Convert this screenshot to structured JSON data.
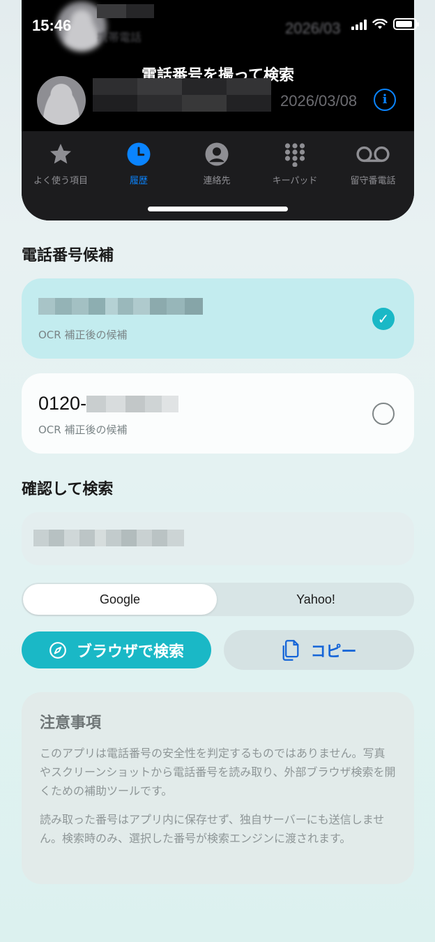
{
  "status_bar": {
    "time": "15:46"
  },
  "screenshot": {
    "rows": [
      {
        "label": "携帯電話",
        "date": "2026/03"
      },
      {
        "label": "",
        "date": "2026/03/08"
      }
    ],
    "overlay_text": "電話番号を撮って検索",
    "info_icon": "info-circle-icon",
    "tabs": [
      {
        "label": "よく使う項目",
        "icon": "star-icon",
        "active": false
      },
      {
        "label": "履歴",
        "icon": "clock-icon",
        "active": true
      },
      {
        "label": "連絡先",
        "icon": "person-circle-icon",
        "active": false
      },
      {
        "label": "キーパッド",
        "icon": "keypad-icon",
        "active": false
      },
      {
        "label": "留守番電話",
        "icon": "voicemail-icon",
        "active": false
      }
    ]
  },
  "candidates": {
    "title": "電話番号候補",
    "items": [
      {
        "number": "",
        "subtitle": "OCR 補正後の候補",
        "selected": true
      },
      {
        "number": "0120-",
        "subtitle": "OCR 補正後の候補",
        "selected": false
      }
    ]
  },
  "confirm": {
    "title": "確認して検索",
    "value": ""
  },
  "engines": {
    "options": [
      "Google",
      "Yahoo!"
    ],
    "selected": "Google"
  },
  "actions": {
    "search_label": "ブラウザで検索",
    "copy_label": "コピー"
  },
  "notice": {
    "title": "注意事項",
    "paragraphs": [
      "このアプリは電話番号の安全性を判定するものではありません。写真やスクリーンショットから電話番号を読み取り、外部ブラウザ検索を開くための補助ツールです。",
      "読み取った番号はアプリ内に保存せず、独自サーバーにも送信しません。検索時のみ、選択した番号が検索エンジンに渡されます。"
    ]
  },
  "colors": {
    "accent": "#1ab8c6",
    "selected_card": "#c3ecef",
    "ios_blue": "#0a84ff",
    "copy_text": "#1565d8"
  }
}
